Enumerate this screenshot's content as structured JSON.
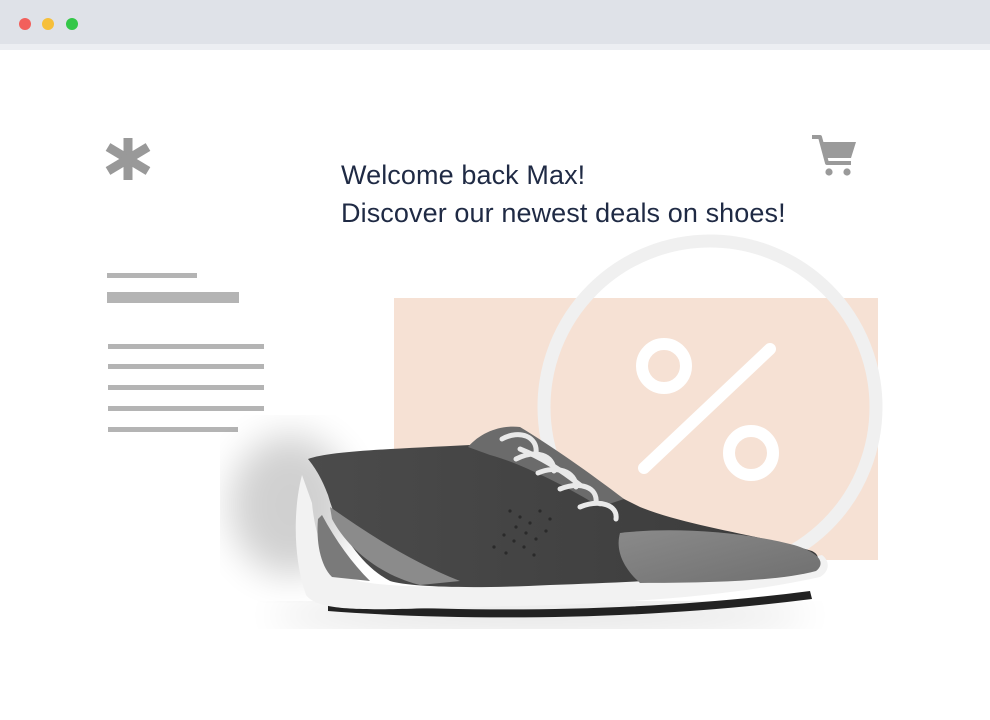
{
  "window": {
    "controls": [
      "close",
      "minimize",
      "maximize"
    ],
    "colors": {
      "close": "#f2605c",
      "minimize": "#f6bf3a",
      "maximize": "#33c748"
    }
  },
  "header": {
    "logo_icon": "asterisk-logo-icon",
    "cart_icon": "shopping-cart-icon"
  },
  "hero": {
    "greeting": "Welcome back Max!",
    "tagline": "Discover our newest deals on shoes!"
  },
  "promo": {
    "symbol": "%",
    "background_color": "#f6e1d4"
  },
  "product": {
    "image": "sneaker-image"
  },
  "colors": {
    "text": "#1f2a44",
    "placeholder": "#b4b4b4",
    "icon": "#999999"
  }
}
